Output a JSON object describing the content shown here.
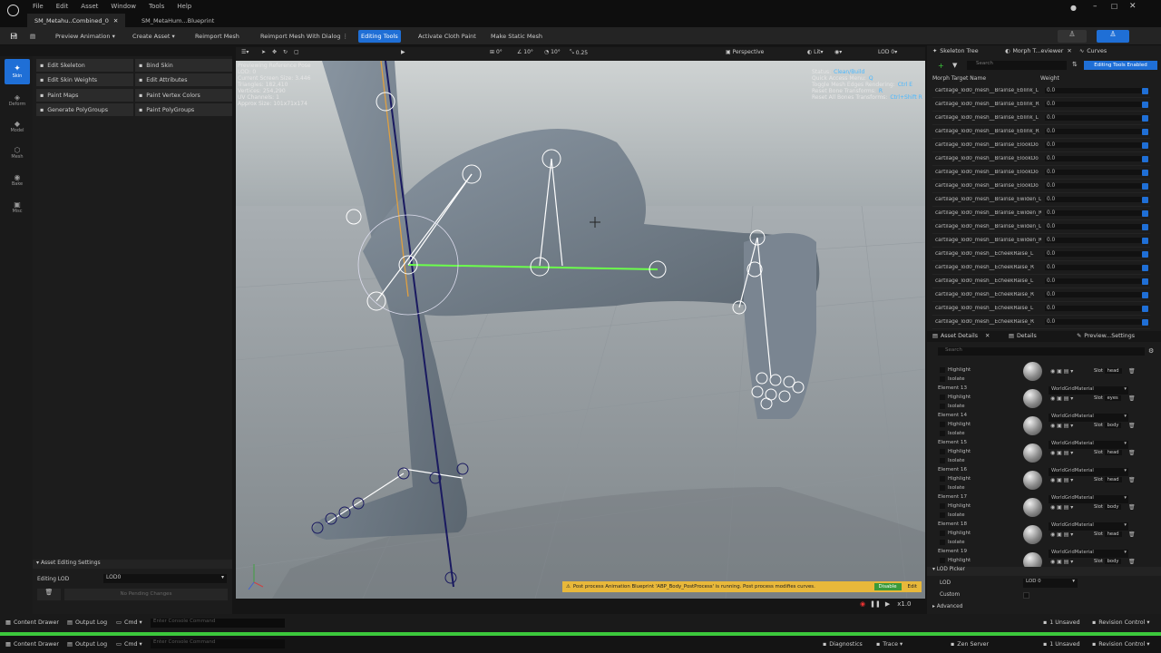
{
  "menu": [
    "File",
    "Edit",
    "Asset",
    "Window",
    "Tools",
    "Help"
  ],
  "doc_tabs": [
    {
      "label": "SM_Metahu..Combined_0",
      "active": true
    },
    {
      "label": "SM_MetaHum...Blueprint",
      "active": false
    }
  ],
  "toolbar": {
    "preview_animation": "Preview Animation",
    "create_asset": "Create Asset",
    "reimport_mesh": "Reimport Mesh",
    "reimport_dialog": "Reimport Mesh With Dialog",
    "editing_tools": "Editing Tools",
    "activate_cloth": "Activate Cloth Paint",
    "make_static": "Make Static Mesh"
  },
  "modes": [
    "Skin",
    "Deform",
    "Model",
    "Mesh",
    "Bake",
    "Misc"
  ],
  "tools": [
    [
      "Edit Skeleton",
      "Bind Skin"
    ],
    [
      "Edit Skin Weights",
      "Edit Attributes"
    ],
    [
      "Paint Maps",
      "Paint Vertex Colors"
    ],
    [
      "Generate PolyGroups",
      "Paint PolyGroups"
    ]
  ],
  "asset_editing": {
    "header": "Asset Editing Settings",
    "lod_label": "Editing LOD",
    "lod_value": "LOD0",
    "pending": "No Pending Changes"
  },
  "viewport_toolbar": {
    "snap1": "0°",
    "snap2": "10°",
    "snap3": "10°",
    "scale": "0.25",
    "perspective": "Perspective",
    "lit": "Lit",
    "lod": "LOD 0"
  },
  "stats": [
    "Previewing Reference Pose",
    "LOD: 0",
    "Current Screen Size: 3.446",
    "Triangles: 182,410",
    "Vertices: 254,290",
    "UV Channels: 1",
    "Approx Size: 101x71x174"
  ],
  "shortcuts": [
    [
      "Status:",
      "Clean/Build"
    ],
    [
      "Quick Access Menu:",
      "Q"
    ],
    [
      "Toggle Mesh Edges Rendering:",
      "Ctrl E"
    ],
    [
      "Reset Bone Transforms:",
      "R"
    ],
    [
      "Reset All Bones Transforms:",
      "Ctrl+Shift R"
    ]
  ],
  "warning": {
    "text": "Post process Animation Blueprint 'ABP_Body_PostProcess' is running. Post process modifies curves.",
    "disable": "Disable",
    "edit": "Edit"
  },
  "playback": {
    "speed": "x1.0"
  },
  "right_tabs": {
    "skeleton_tree": "Skeleton Tree",
    "morph": "Morph T...eviewer",
    "curves": "Curves",
    "search": "Search",
    "editing_tools_enabled": "Editing Tools Enabled",
    "col_name": "Morph Target Name",
    "col_weight": "Weight"
  },
  "morphs": [
    [
      "cartilage_lod0_mesh__Brainse_Eblink_L",
      "0.0"
    ],
    [
      "cartilage_lod0_mesh__Brainse_Eblink_R",
      "0.0"
    ],
    [
      "cartilage_lod0_mesh__Brainse_Eblink_L",
      "0.0"
    ],
    [
      "cartilage_lod0_mesh__Brainse_Eblink_R",
      "0.0"
    ],
    [
      "cartilage_lod0_mesh__Brainse_ElookDo",
      "0.0"
    ],
    [
      "cartilage_lod0_mesh__Brainse_ElookDo",
      "0.0"
    ],
    [
      "cartilage_lod0_mesh__Brainse_ElookDo",
      "0.0"
    ],
    [
      "cartilage_lod0_mesh__Brainse_ElookDo",
      "0.0"
    ],
    [
      "cartilage_lod0_mesh__Brainse_Ewiden_L",
      "0.0"
    ],
    [
      "cartilage_lod0_mesh__Brainse_Ewiden_R",
      "0.0"
    ],
    [
      "cartilage_lod0_mesh__Brainse_Ewiden_L",
      "0.0"
    ],
    [
      "cartilage_lod0_mesh__Brainse_Ewiden_R",
      "0.0"
    ],
    [
      "cartilage_lod0_mesh__EcheekRaise_L",
      "0.0"
    ],
    [
      "cartilage_lod0_mesh__EcheekRaise_R",
      "0.0"
    ],
    [
      "cartilage_lod0_mesh__EcheekRaise_L",
      "0.0"
    ],
    [
      "cartilage_lod0_mesh__EcheekRaise_R",
      "0.0"
    ],
    [
      "cartilage_lod0_mesh__EcheekRaise_L",
      "0.0"
    ],
    [
      "cartilage_lod0_mesh__EcheekRaise_R",
      "0.0"
    ]
  ],
  "details_tabs": {
    "asset_details": "Asset Details",
    "details": "Details",
    "preview": "Preview...Settings",
    "search": "Search"
  },
  "elements": [
    {
      "name": "",
      "mat": "",
      "slot": "head"
    },
    {
      "name": "Element 13",
      "mat": "WorldGridMaterial",
      "slot": "eyes"
    },
    {
      "name": "Element 14",
      "mat": "WorldGridMaterial",
      "slot": "body"
    },
    {
      "name": "Element 15",
      "mat": "WorldGridMaterial",
      "slot": "head"
    },
    {
      "name": "Element 16",
      "mat": "WorldGridMaterial",
      "slot": "head"
    },
    {
      "name": "Element 17",
      "mat": "WorldGridMaterial",
      "slot": "body"
    },
    {
      "name": "Element 18",
      "mat": "WorldGridMaterial",
      "slot": "head"
    },
    {
      "name": "Element 19",
      "mat": "WorldGridMaterial",
      "slot": "body"
    }
  ],
  "element_labels": {
    "highlight": "Highlight",
    "isolate": "Isolate",
    "slot_prefix": "Slot"
  },
  "lod_picker": {
    "header": "LOD Picker",
    "lod": "LOD",
    "value": "LOD 0",
    "custom": "Custom",
    "advanced": "Advanced"
  },
  "bottom": {
    "content_drawer": "Content Drawer",
    "output_log": "Output Log",
    "cmd": "Cmd",
    "console": "Enter Console Command",
    "unsaved": "1 Unsaved",
    "revision": "Revision Control",
    "diagnostics": "Diagnostics",
    "trace": "Trace",
    "zen": "Zen Server"
  }
}
